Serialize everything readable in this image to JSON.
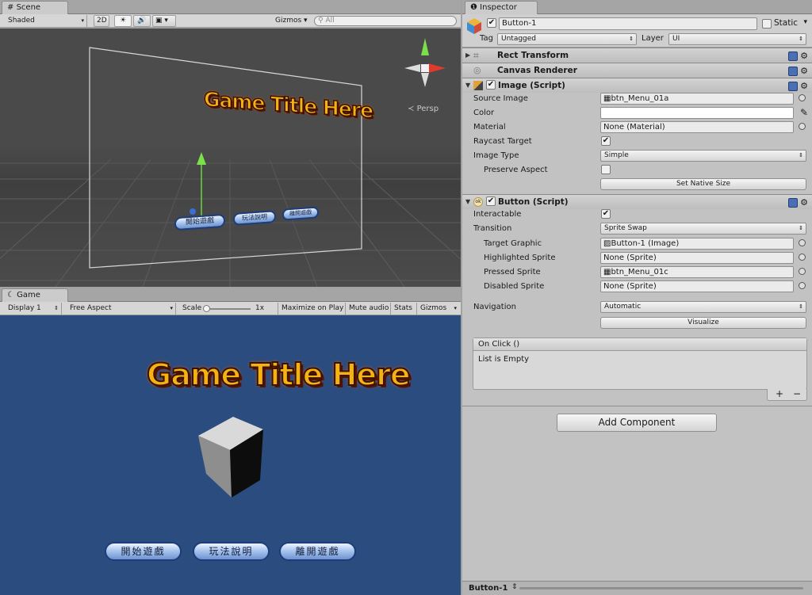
{
  "scene": {
    "tab_label": "Scene",
    "shading_mode": "Shaded",
    "mode_2d": "2D",
    "gizmos_label": "Gizmos",
    "search_placeholder": "All",
    "persp_label": "Persp",
    "title_text": "Game Title Here",
    "buttons": [
      "開始遊戲",
      "玩法說明",
      "離開遊戲"
    ]
  },
  "game": {
    "tab_label": "Game",
    "display": "Display 1",
    "aspect": "Free Aspect",
    "scale_label": "Scale",
    "scale_value": "1x",
    "maximize": "Maximize on Play",
    "mute": "Mute audio",
    "stats": "Stats",
    "gizmos": "Gizmos",
    "title_text": "Game Title Here",
    "buttons": [
      "開始遊戲",
      "玩法說明",
      "離開遊戲"
    ]
  },
  "inspector": {
    "tab_label": "Inspector",
    "object_name": "Button-1",
    "static_label": "Static",
    "tag_label": "Tag",
    "tag_value": "Untagged",
    "layer_label": "Layer",
    "layer_value": "UI",
    "rect_transform": "Rect Transform",
    "canvas_renderer": "Canvas Renderer",
    "image_script": {
      "title": "Image (Script)",
      "source_image_label": "Source Image",
      "source_image_value": "btn_Menu_01a",
      "color_label": "Color",
      "material_label": "Material",
      "material_value": "None (Material)",
      "raycast_label": "Raycast Target",
      "image_type_label": "Image Type",
      "image_type_value": "Simple",
      "preserve_label": "Preserve Aspect",
      "native_size_button": "Set Native Size"
    },
    "button_script": {
      "title": "Button (Script)",
      "interactable_label": "Interactable",
      "transition_label": "Transition",
      "transition_value": "Sprite Swap",
      "target_graphic_label": "Target Graphic",
      "target_graphic_value": "Button-1 (Image)",
      "highlighted_label": "Highlighted Sprite",
      "highlighted_value": "None (Sprite)",
      "pressed_label": "Pressed Sprite",
      "pressed_value": "btn_Menu_01c",
      "disabled_label": "Disabled Sprite",
      "disabled_value": "None (Sprite)",
      "navigation_label": "Navigation",
      "navigation_value": "Automatic",
      "visualize_button": "Visualize",
      "onclick_header": "On Click ()",
      "onclick_empty": "List is Empty",
      "plus": "+",
      "minus": "−"
    },
    "add_component": "Add Component",
    "footer_label": "Button-1"
  }
}
